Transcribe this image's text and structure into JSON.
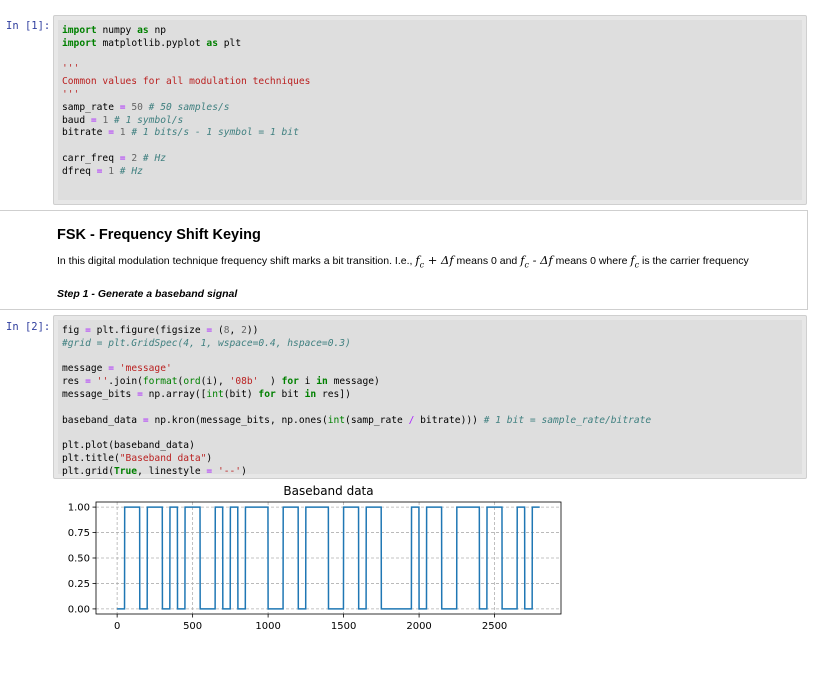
{
  "cells": [
    {
      "prompt": "In [1]:",
      "lines": [
        [
          [
            "kw",
            "import"
          ],
          [
            "",
            "numpy"
          ],
          [
            "kw",
            "as"
          ],
          [
            "",
            "np"
          ]
        ],
        [
          [
            "kw",
            "import"
          ],
          [
            "",
            "matplotlib.pyplot"
          ],
          [
            "kw",
            "as"
          ],
          [
            "",
            "plt"
          ]
        ],
        [],
        [
          [
            "st",
            "'''"
          ]
        ],
        [
          [
            "st",
            "Common values for all modulation techniques"
          ]
        ],
        [
          [
            "st",
            "'''"
          ]
        ],
        [
          [
            "",
            "samp_rate"
          ],
          [
            "op",
            "="
          ],
          [
            "num2",
            "50"
          ],
          [
            "cm",
            "# 50 samples/s"
          ]
        ],
        [
          [
            "",
            "baud"
          ],
          [
            "op",
            "="
          ],
          [
            "num2",
            "1"
          ],
          [
            "cm",
            "# 1 symbol/s"
          ]
        ],
        [
          [
            "",
            "bitrate"
          ],
          [
            "op",
            "="
          ],
          [
            "num2",
            "1"
          ],
          [
            "cm",
            "# 1 bits/s - 1 symbol = 1 bit"
          ]
        ],
        [],
        [
          [
            "",
            "carr_freq"
          ],
          [
            "op",
            "="
          ],
          [
            "num2",
            "2"
          ],
          [
            "cm",
            "# Hz"
          ]
        ],
        [
          [
            "",
            "dfreq"
          ],
          [
            "op",
            "="
          ],
          [
            "num2",
            "1"
          ],
          [
            "cm",
            "# Hz"
          ]
        ]
      ]
    },
    {
      "prompt": "In [2]:",
      "lines": [
        [
          [
            "",
            "fig"
          ],
          [
            "op",
            "="
          ],
          [
            "",
            "plt.figure(figsize"
          ],
          [
            "op",
            "="
          ],
          [
            "",
            "("
          ],
          [
            "num2",
            "8"
          ],
          [
            "",
            ","
          ],
          [
            "num2",
            "2"
          ],
          [
            "",
            "))"
          ]
        ],
        [
          [
            "cm",
            "#grid = plt.GridSpec(4, 1, wspace=0.4, hspace=0.3)"
          ]
        ],
        [],
        [
          [
            "",
            "message"
          ],
          [
            "op",
            "="
          ],
          [
            "st",
            "'message'"
          ]
        ],
        [
          [
            "",
            "res"
          ],
          [
            "op",
            "="
          ],
          [
            "st",
            "''"
          ],
          [
            "",
            ".join("
          ],
          [
            "bi",
            "format"
          ],
          [
            "",
            "("
          ],
          [
            "bi",
            "ord"
          ],
          [
            "",
            "(i),"
          ],
          [
            "st",
            "'08b'"
          ],
          [
            "",
            " )"
          ],
          [
            "kw",
            "for"
          ],
          [
            "",
            "i"
          ],
          [
            "kw",
            "in"
          ],
          [
            "",
            "message)"
          ]
        ],
        [
          [
            "",
            "message_bits"
          ],
          [
            "op",
            "="
          ],
          [
            "",
            "np.array(["
          ],
          [
            "bi",
            "int"
          ],
          [
            "",
            "(bit)"
          ],
          [
            "kw",
            "for"
          ],
          [
            "",
            "bit"
          ],
          [
            "kw",
            "in"
          ],
          [
            "",
            "res])"
          ]
        ],
        [],
        [
          [
            "",
            "baseband_data"
          ],
          [
            "op",
            "="
          ],
          [
            "",
            "np.kron(message_bits, np.ones("
          ],
          [
            "bi",
            "int"
          ],
          [
            "",
            "(samp_rate"
          ],
          [
            "op",
            "/"
          ],
          [
            "",
            "bitrate)))"
          ],
          [
            "cm",
            "# 1 bit = sample_rate/bitrate"
          ]
        ],
        [],
        [
          [
            "",
            "plt.plot(baseband_data)"
          ]
        ],
        [
          [
            "",
            "plt.title("
          ],
          [
            "st",
            "\"Baseband data\""
          ],
          [
            "",
            ")"
          ]
        ],
        [
          [
            "",
            "plt.grid("
          ],
          [
            "kw",
            "True"
          ],
          [
            "",
            ", linestyle"
          ],
          [
            "op",
            "="
          ],
          [
            "st",
            "'--'"
          ],
          [
            "",
            ")"
          ]
        ]
      ]
    }
  ],
  "markdown": {
    "title": "FSK - Frequency Shift Keying",
    "text_before": "In this digital modulation technique frequency shift marks a bit transition. I.e., ",
    "text_mid1": " means 0 and ",
    "text_mid2": " means 0 where ",
    "text_after": " is the carrier frequency",
    "math_plus": "f",
    "math_sub": "c",
    "math_plus_delta": " + Δ",
    "math_minus_delta": " - Δ",
    "math_f": "f",
    "step": "Step 1 - Generate a baseband signal"
  },
  "chart_data": {
    "type": "line",
    "title": "Baseband data",
    "xlabel": "",
    "ylabel": "",
    "xlim": [
      -140,
      2940
    ],
    "ylim": [
      -0.05,
      1.05
    ],
    "xticks": [
      0,
      500,
      1000,
      1500,
      2000,
      2500
    ],
    "yticks": [
      0.0,
      0.25,
      0.5,
      0.75,
      1.0
    ],
    "ytick_labels": [
      "0.00",
      "0.25",
      "0.50",
      "0.75",
      "1.00"
    ],
    "grid": true,
    "line_color": "#1f77b4",
    "samples_per_bit": 50,
    "bits": [
      0,
      1,
      1,
      0,
      1,
      1,
      0,
      1,
      0,
      1,
      1,
      0,
      0,
      1,
      0,
      1,
      0,
      1,
      1,
      1,
      0,
      0,
      1,
      1,
      0,
      1,
      1,
      1,
      0,
      0,
      1,
      1,
      0,
      1,
      1,
      0,
      0,
      0,
      0,
      1,
      0,
      1,
      1,
      0,
      0,
      1,
      1,
      1,
      0,
      1,
      1,
      0,
      0,
      1,
      0,
      1
    ],
    "series": [
      {
        "values_desc": "np.kron of bits with ones(50)"
      }
    ]
  }
}
